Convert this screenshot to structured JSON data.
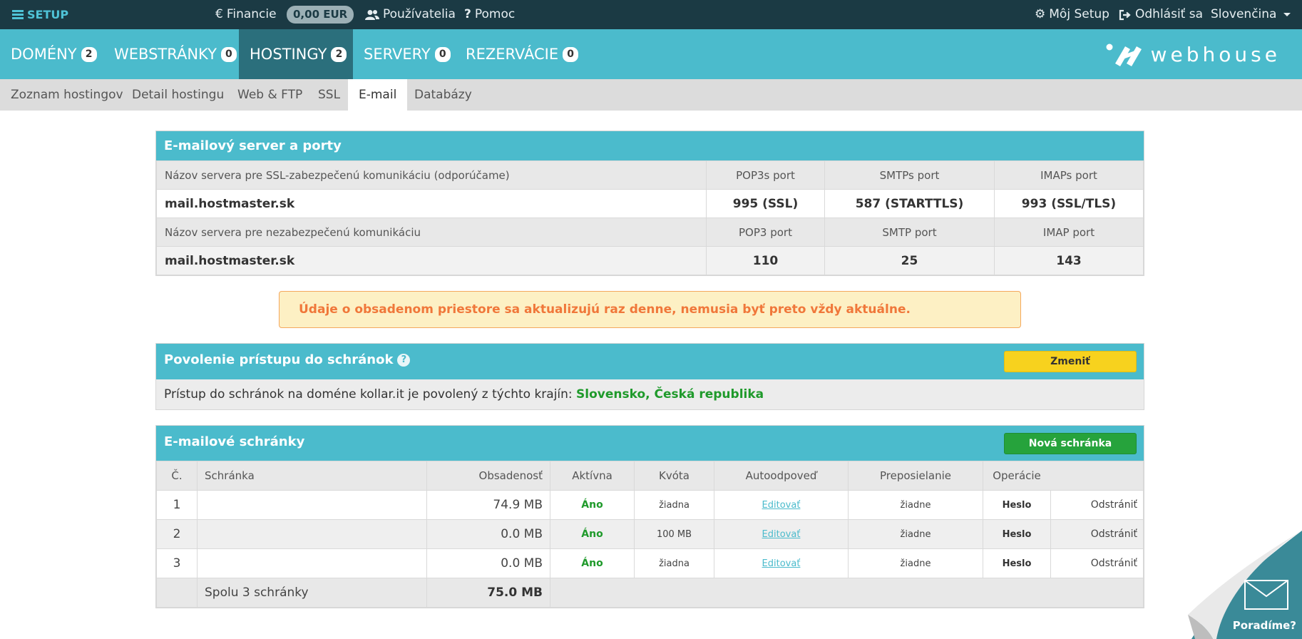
{
  "topbar": {
    "brand": "SETUP",
    "finance": "Financie",
    "balance": "0,00 EUR",
    "users": "Používatelia",
    "help": "Pomoc",
    "my_setup": "Môj Setup",
    "logout": "Odhlásiť sa",
    "language": "Slovenčina"
  },
  "mainnav": [
    {
      "label": "DOMÉNY",
      "count": "2"
    },
    {
      "label": "WEBSTRÁNKY",
      "count": "0"
    },
    {
      "label": "HOSTINGY",
      "count": "2"
    },
    {
      "label": "SERVERY",
      "count": "0"
    },
    {
      "label": "REZERVÁCIE",
      "count": "0"
    }
  ],
  "logo_text": "webhouse",
  "subnav": [
    "Zoznam hostingov",
    "Detail hostingu",
    "Web & FTP",
    "SSL",
    "E-mail",
    "Databázy"
  ],
  "server": {
    "title": "E-mailový server a porty",
    "ssl_label": "Názov servera pre SSL-zabezpečenú komunikáciu (odporúčame)",
    "ssl_cols": [
      "POP3s port",
      "SMTPs port",
      "IMAPs port"
    ],
    "ssl_host": "mail.hostmaster.sk",
    "ssl_values": [
      "995 (SSL)",
      "587 (STARTTLS)",
      "993 (SSL/TLS)"
    ],
    "plain_label": "Názov servera pre nezabezpečenú komunikáciu",
    "plain_cols": [
      "POP3 port",
      "SMTP port",
      "IMAP port"
    ],
    "plain_host": "mail.hostmaster.sk",
    "plain_values": [
      "110",
      "25",
      "143"
    ]
  },
  "alert": "Údaje o obsadenom priestore sa aktualizujú raz denne, nemusia byť preto vždy aktuálne.",
  "access": {
    "title": "Povolenie prístupu do schránok",
    "change_button": "Zmeniť",
    "text": "Prístup do schránok na doméne kollar.it je povolený z týchto krajín:",
    "countries": "Slovensko, Česká republika"
  },
  "mailboxes": {
    "title": "E-mailové schránky",
    "new_button": "Nová schránka",
    "headers": [
      "Č.",
      "Schránka",
      "Obsadenosť",
      "Aktívna",
      "Kvóta",
      "Autoodpoveď",
      "Preposielanie",
      "Operácie"
    ],
    "rows": [
      {
        "no": "1",
        "name": "",
        "usage": "74.9 MB",
        "active": "Áno",
        "quota": "žiadna",
        "autoreply": "Editovať",
        "forward": "žiadne",
        "password": "Heslo",
        "delete": "Odstrániť"
      },
      {
        "no": "2",
        "name": "",
        "usage": "0.0 MB",
        "active": "Áno",
        "quota": "100 MB",
        "autoreply": "Editovať",
        "forward": "žiadne",
        "password": "Heslo",
        "delete": "Odstrániť"
      },
      {
        "no": "3",
        "name": "",
        "usage": "0.0 MB",
        "active": "Áno",
        "quota": "žiadna",
        "autoreply": "Editovať",
        "forward": "žiadne",
        "password": "Heslo",
        "delete": "Odstrániť"
      }
    ],
    "total_label": "Spolu 3 schránky",
    "total_usage": "75.0 MB"
  },
  "curl_text": "Poradíme?"
}
